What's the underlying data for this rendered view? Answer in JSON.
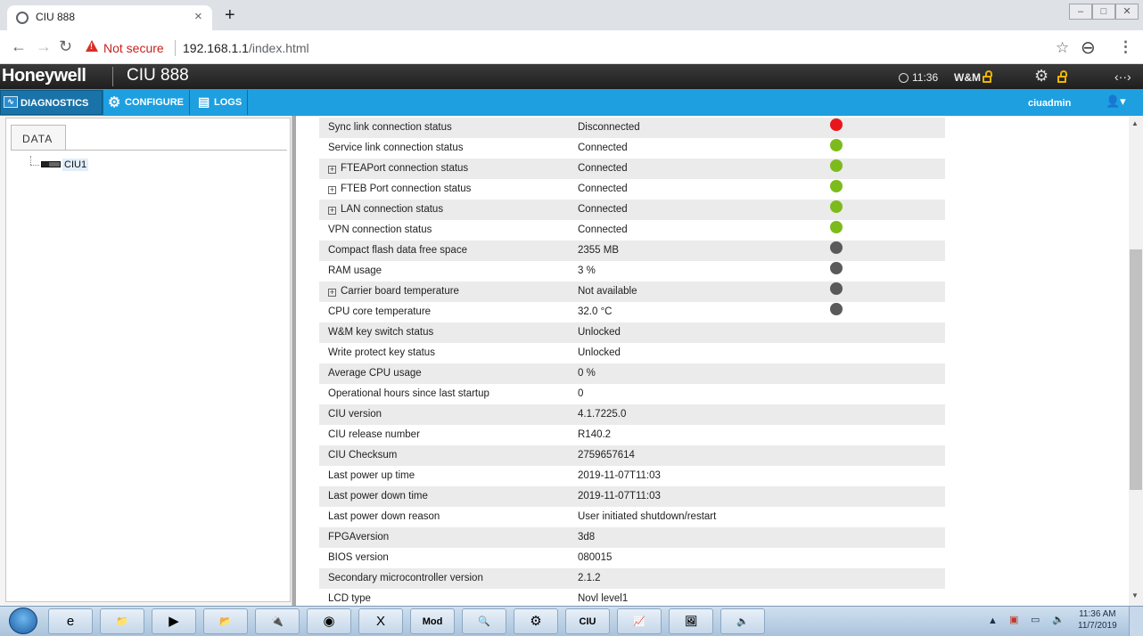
{
  "browser": {
    "tab_title": "CIU 888",
    "not_secure_label": "Not secure",
    "url_host": "192.168.1.1",
    "url_path": "/index.html",
    "window_controls": [
      "–",
      "□",
      "✕"
    ]
  },
  "app": {
    "brand": "Honeywell",
    "product": "CIU 888",
    "clock": "11:36",
    "wm_label": "W&M",
    "menu": {
      "diagnostics": "DIAGNOSTICS",
      "configure": "CONFIGURE",
      "logs": "LOGS"
    },
    "user": "ciuadmin"
  },
  "sidebar": {
    "tab": "DATA",
    "tree_item": "CIU1"
  },
  "status_rows": [
    {
      "label": "Sync link connection status",
      "value": "Disconnected",
      "status": "red",
      "expand": false
    },
    {
      "label": "Service link connection status",
      "value": "Connected",
      "status": "green",
      "expand": false
    },
    {
      "label": "FTEAPort connection status",
      "value": "Connected",
      "status": "green",
      "expand": true
    },
    {
      "label": "FTEB Port connection status",
      "value": "Connected",
      "status": "green",
      "expand": true
    },
    {
      "label": "LAN connection status",
      "value": "Connected",
      "status": "green",
      "expand": true
    },
    {
      "label": "VPN connection status",
      "value": "Connected",
      "status": "green",
      "expand": false
    },
    {
      "label": "Compact flash data free space",
      "value": "2355 MB",
      "status": "gray",
      "expand": false
    },
    {
      "label": "RAM usage",
      "value": "3 %",
      "status": "gray",
      "expand": false
    },
    {
      "label": "Carrier board temperature",
      "value": "Not available",
      "status": "gray",
      "expand": true
    },
    {
      "label": "CPU core temperature",
      "value": "32.0 °C",
      "status": "gray",
      "expand": false
    },
    {
      "label": "W&M key switch status",
      "value": "Unlocked",
      "status": "",
      "expand": false
    },
    {
      "label": "Write protect key status",
      "value": "Unlocked",
      "status": "",
      "expand": false
    },
    {
      "label": "Average CPU usage",
      "value": "0 %",
      "status": "",
      "expand": false
    },
    {
      "label": "Operational hours since last startup",
      "value": "0",
      "status": "",
      "expand": false
    },
    {
      "label": "CIU version",
      "value": "4.1.7225.0",
      "status": "",
      "expand": false
    },
    {
      "label": "CIU release number",
      "value": "R140.2",
      "status": "",
      "expand": false
    },
    {
      "label": "CIU Checksum",
      "value": "2759657614",
      "status": "",
      "expand": false
    },
    {
      "label": "Last power up time",
      "value": "2019-11-07T11:03",
      "status": "",
      "expand": false
    },
    {
      "label": "Last power down time",
      "value": "2019-11-07T11:03",
      "status": "",
      "expand": false
    },
    {
      "label": "Last power down reason",
      "value": "User initiated shutdown/restart",
      "status": "",
      "expand": false
    },
    {
      "label": "FPGAversion",
      "value": "3d8",
      "status": "",
      "expand": false
    },
    {
      "label": "BIOS version",
      "value": "080015",
      "status": "",
      "expand": false
    },
    {
      "label": "Secondary microcontroller version",
      "value": "2.1.2",
      "status": "",
      "expand": false
    },
    {
      "label": "LCD type",
      "value": "Novl level1",
      "status": "",
      "expand": false
    }
  ],
  "status_colors": {
    "red": "#e8161b",
    "green": "#7dbb1c",
    "gray": "#5a5a5a"
  },
  "taskbar": {
    "apps": [
      {
        "name": "internet-explorer-icon",
        "glyph": "e"
      },
      {
        "name": "file-explorer-icon",
        "glyph": "📁"
      },
      {
        "name": "media-player-icon",
        "glyph": "▶"
      },
      {
        "name": "folder-icon",
        "glyph": "📂"
      },
      {
        "name": "network-tool-icon",
        "glyph": "🔌"
      },
      {
        "name": "chrome-icon",
        "glyph": "◉"
      },
      {
        "name": "excel-icon",
        "glyph": "X"
      },
      {
        "name": "modbus-icon",
        "glyph": "Mod"
      },
      {
        "name": "search-tool-icon",
        "glyph": "🔍"
      },
      {
        "name": "network-scan-icon",
        "glyph": "⚙"
      },
      {
        "name": "ciu-app-icon",
        "glyph": "CIU"
      },
      {
        "name": "chart-tool-icon",
        "glyph": "📈"
      },
      {
        "name": "image-viewer-icon",
        "glyph": "🖼"
      },
      {
        "name": "audio-tool-icon",
        "glyph": "🔈"
      }
    ],
    "time": "11:36 AM",
    "date": "11/7/2019"
  }
}
